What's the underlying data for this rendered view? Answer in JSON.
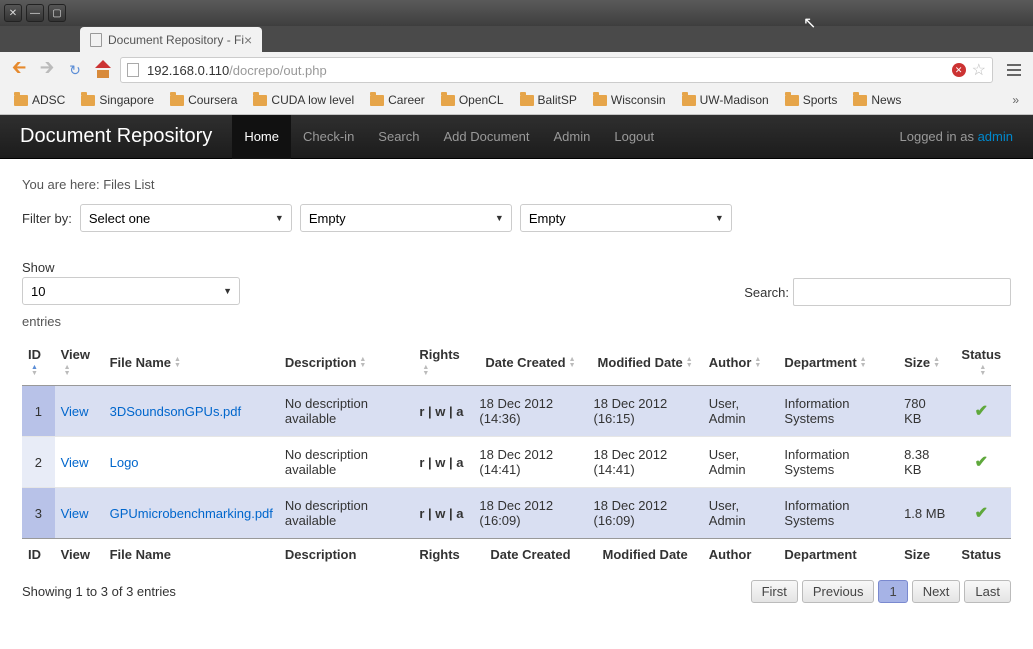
{
  "window": {
    "tab_title": "Document Repository - Fi"
  },
  "browser": {
    "url_host": "192.168.0.110",
    "url_path": "/docrepo/out.php",
    "bookmarks": [
      "ADSC",
      "Singapore",
      "Coursera",
      "CUDA low level",
      "Career",
      "OpenCL",
      "BalitSP",
      "Wisconsin",
      "UW-Madison",
      "Sports",
      "News"
    ]
  },
  "navbar": {
    "brand": "Document Repository",
    "links": [
      "Home",
      "Check-in",
      "Search",
      "Add Document",
      "Admin",
      "Logout"
    ],
    "active_index": 0,
    "logged_text": "Logged in as ",
    "username": "admin"
  },
  "breadcrumb": {
    "prefix": "You are here: ",
    "location": "Files List"
  },
  "filter": {
    "label": "Filter by:",
    "select1": "Select one",
    "select2": "Empty",
    "select3": "Empty"
  },
  "datatable": {
    "show_label": "Show",
    "show_value": "10",
    "entries_label": "entries",
    "search_label": "Search:",
    "search_value": "",
    "columns": [
      "ID",
      "View",
      "File Name",
      "Description",
      "Rights",
      "Date Created",
      "Modified Date",
      "Author",
      "Department",
      "Size",
      "Status"
    ],
    "rows": [
      {
        "id": "1",
        "view": "View",
        "filename": "3DSoundsonGPUs.pdf",
        "description": "No description available",
        "rights": "r | w | a",
        "created": "18 Dec 2012 (14:36)",
        "modified": "18 Dec 2012 (16:15)",
        "author": "User, Admin",
        "department": "Information Systems",
        "size": "780 KB",
        "status": "ok"
      },
      {
        "id": "2",
        "view": "View",
        "filename": "Logo",
        "description": "No description available",
        "rights": "r | w | a",
        "created": "18 Dec 2012 (14:41)",
        "modified": "18 Dec 2012 (14:41)",
        "author": "User, Admin",
        "department": "Information Systems",
        "size": "8.38 KB",
        "status": "ok"
      },
      {
        "id": "3",
        "view": "View",
        "filename": "GPUmicrobenchmarking.pdf",
        "description": "No description available",
        "rights": "r | w | a",
        "created": "18 Dec 2012 (16:09)",
        "modified": "18 Dec 2012 (16:09)",
        "author": "User, Admin",
        "department": "Information Systems",
        "size": "1.8 MB",
        "status": "ok"
      }
    ],
    "info": "Showing 1 to 3 of 3 entries",
    "paging": {
      "first": "First",
      "prev": "Previous",
      "pages": [
        "1"
      ],
      "active_page": 0,
      "next": "Next",
      "last": "Last"
    }
  }
}
